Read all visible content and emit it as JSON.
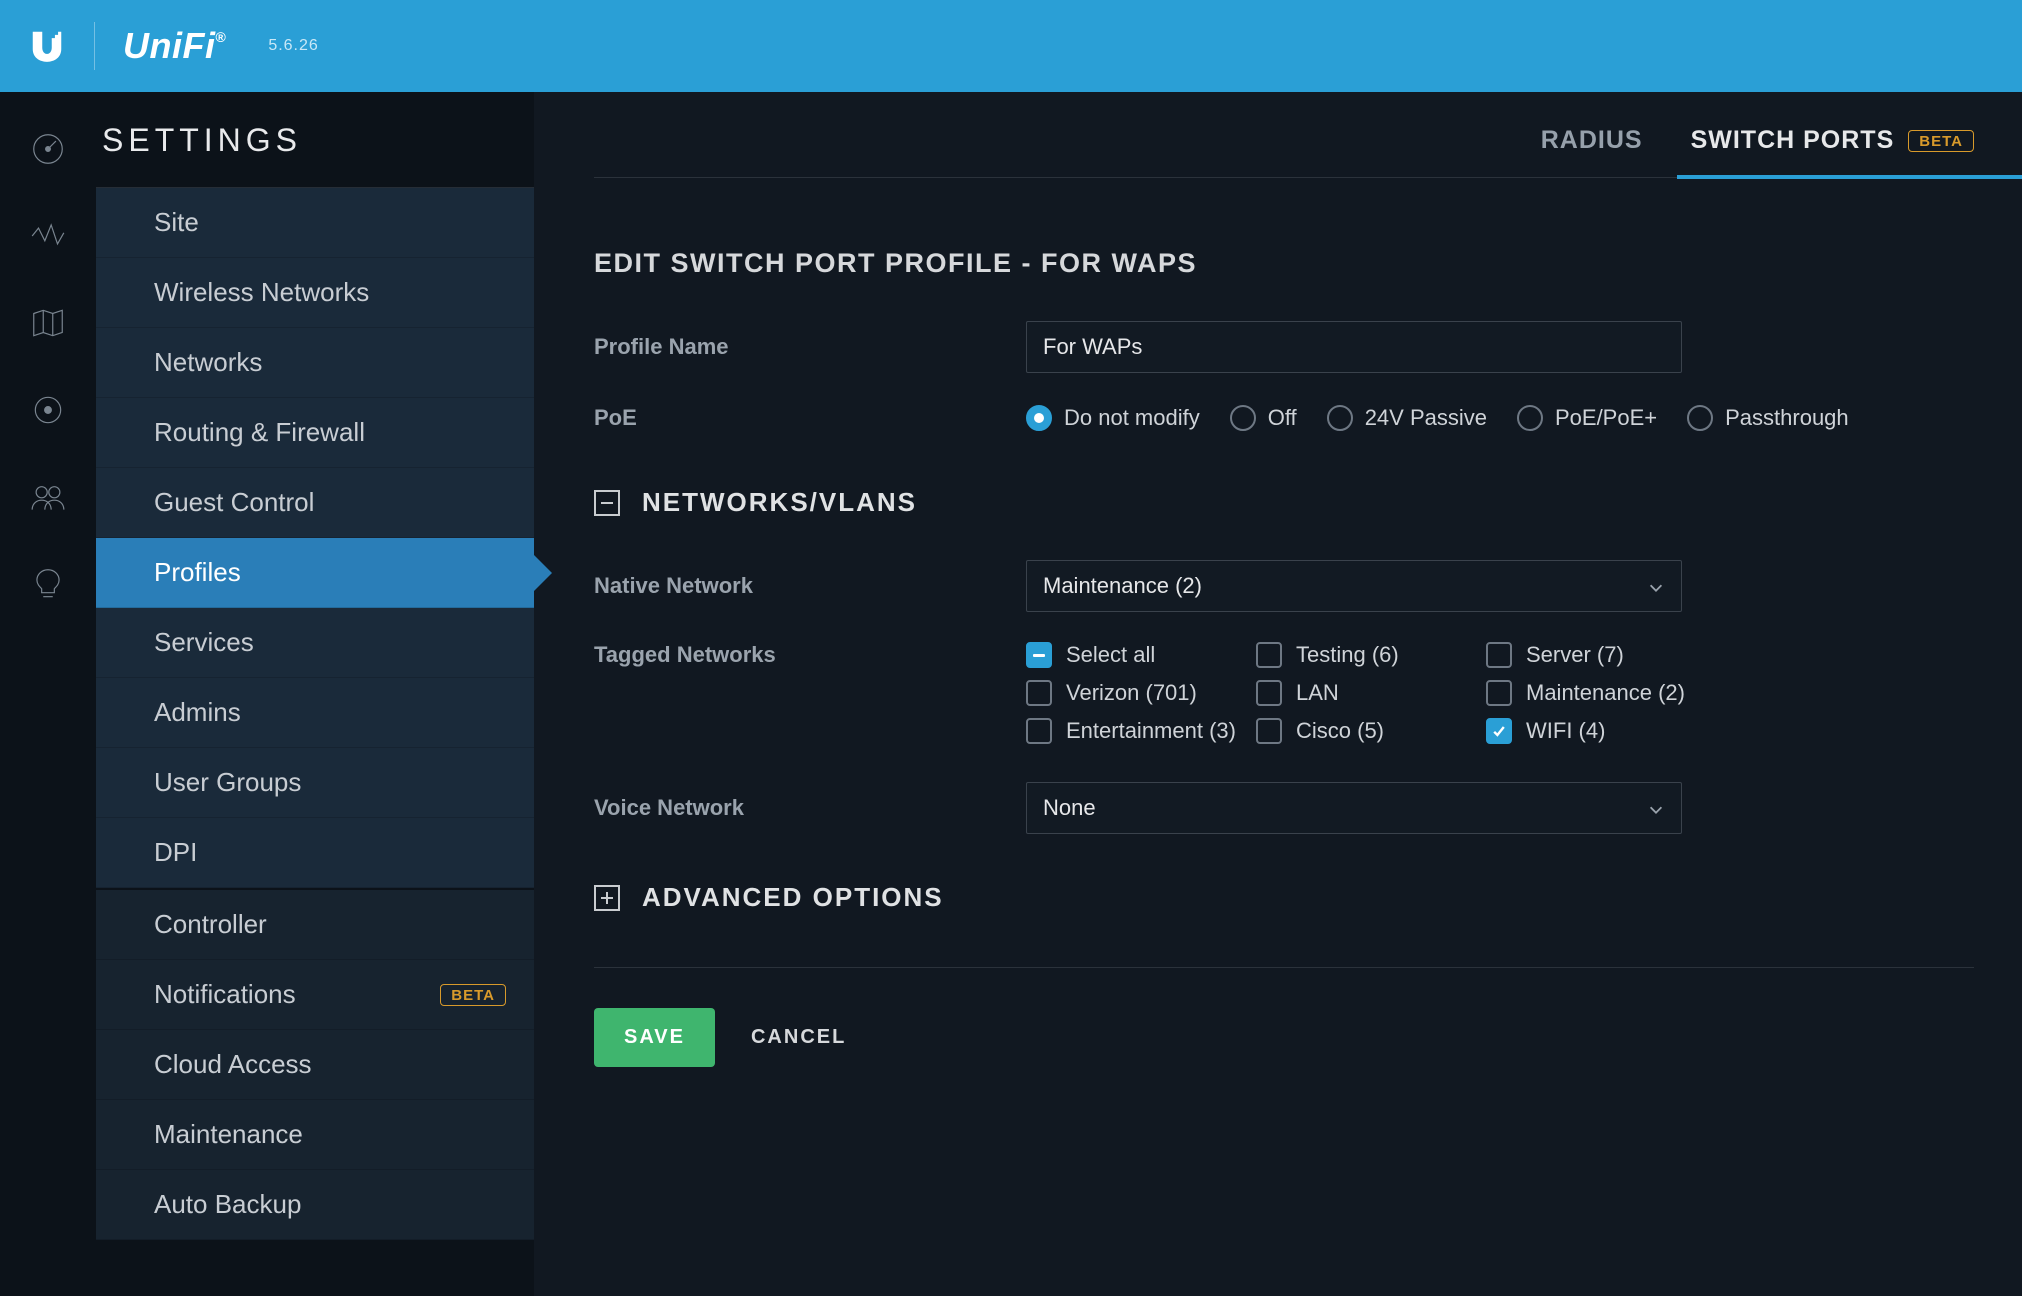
{
  "header": {
    "brand": "UniFi",
    "version": "5.6.26"
  },
  "rail_icons": [
    "dashboard",
    "stats",
    "map",
    "insights",
    "clients",
    "tips"
  ],
  "settings": {
    "title": "SETTINGS",
    "badges": {
      "beta": "BETA"
    },
    "items": [
      {
        "label": "Site"
      },
      {
        "label": "Wireless Networks"
      },
      {
        "label": "Networks"
      },
      {
        "label": "Routing & Firewall"
      },
      {
        "label": "Guest Control"
      },
      {
        "label": "Profiles",
        "active": true
      },
      {
        "label": "Services"
      },
      {
        "label": "Admins"
      },
      {
        "label": "User Groups"
      },
      {
        "label": "DPI"
      },
      {
        "label": "Controller",
        "group": 2
      },
      {
        "label": "Notifications",
        "group": 2,
        "beta": true
      },
      {
        "label": "Cloud Access",
        "group": 2
      },
      {
        "label": "Maintenance",
        "group": 2
      },
      {
        "label": "Auto Backup",
        "group": 2
      }
    ]
  },
  "tabs": [
    {
      "label": "RADIUS",
      "active": false
    },
    {
      "label": "SWITCH PORTS",
      "active": true,
      "beta": true
    }
  ],
  "page": {
    "heading": "EDIT SWITCH PORT PROFILE - FOR WAPS",
    "profile_name_label": "Profile Name",
    "profile_name_value": "For WAPs",
    "poe_label": "PoE",
    "poe_options": [
      {
        "label": "Do not modify",
        "checked": true
      },
      {
        "label": "Off",
        "checked": false
      },
      {
        "label": "24V Passive",
        "checked": false
      },
      {
        "label": "PoE/PoE+",
        "checked": false
      },
      {
        "label": "Passthrough",
        "checked": false
      }
    ],
    "section_networks": "NETWORKS/VLANS",
    "native_network_label": "Native Network",
    "native_network_value": "Maintenance (2)",
    "tagged_networks_label": "Tagged Networks",
    "tagged": [
      {
        "label": "Select all",
        "state": "indeterminate"
      },
      {
        "label": "Testing (6)",
        "state": "unchecked"
      },
      {
        "label": "Server (7)",
        "state": "unchecked"
      },
      {
        "label": "Verizon (701)",
        "state": "unchecked"
      },
      {
        "label": "LAN",
        "state": "unchecked"
      },
      {
        "label": "Maintenance (2)",
        "state": "unchecked"
      },
      {
        "label": "Entertainment (3)",
        "state": "unchecked"
      },
      {
        "label": "Cisco (5)",
        "state": "unchecked"
      },
      {
        "label": "WIFI (4)",
        "state": "checked"
      }
    ],
    "voice_network_label": "Voice Network",
    "voice_network_value": "None",
    "section_advanced": "ADVANCED OPTIONS",
    "save": "SAVE",
    "cancel": "CANCEL"
  }
}
